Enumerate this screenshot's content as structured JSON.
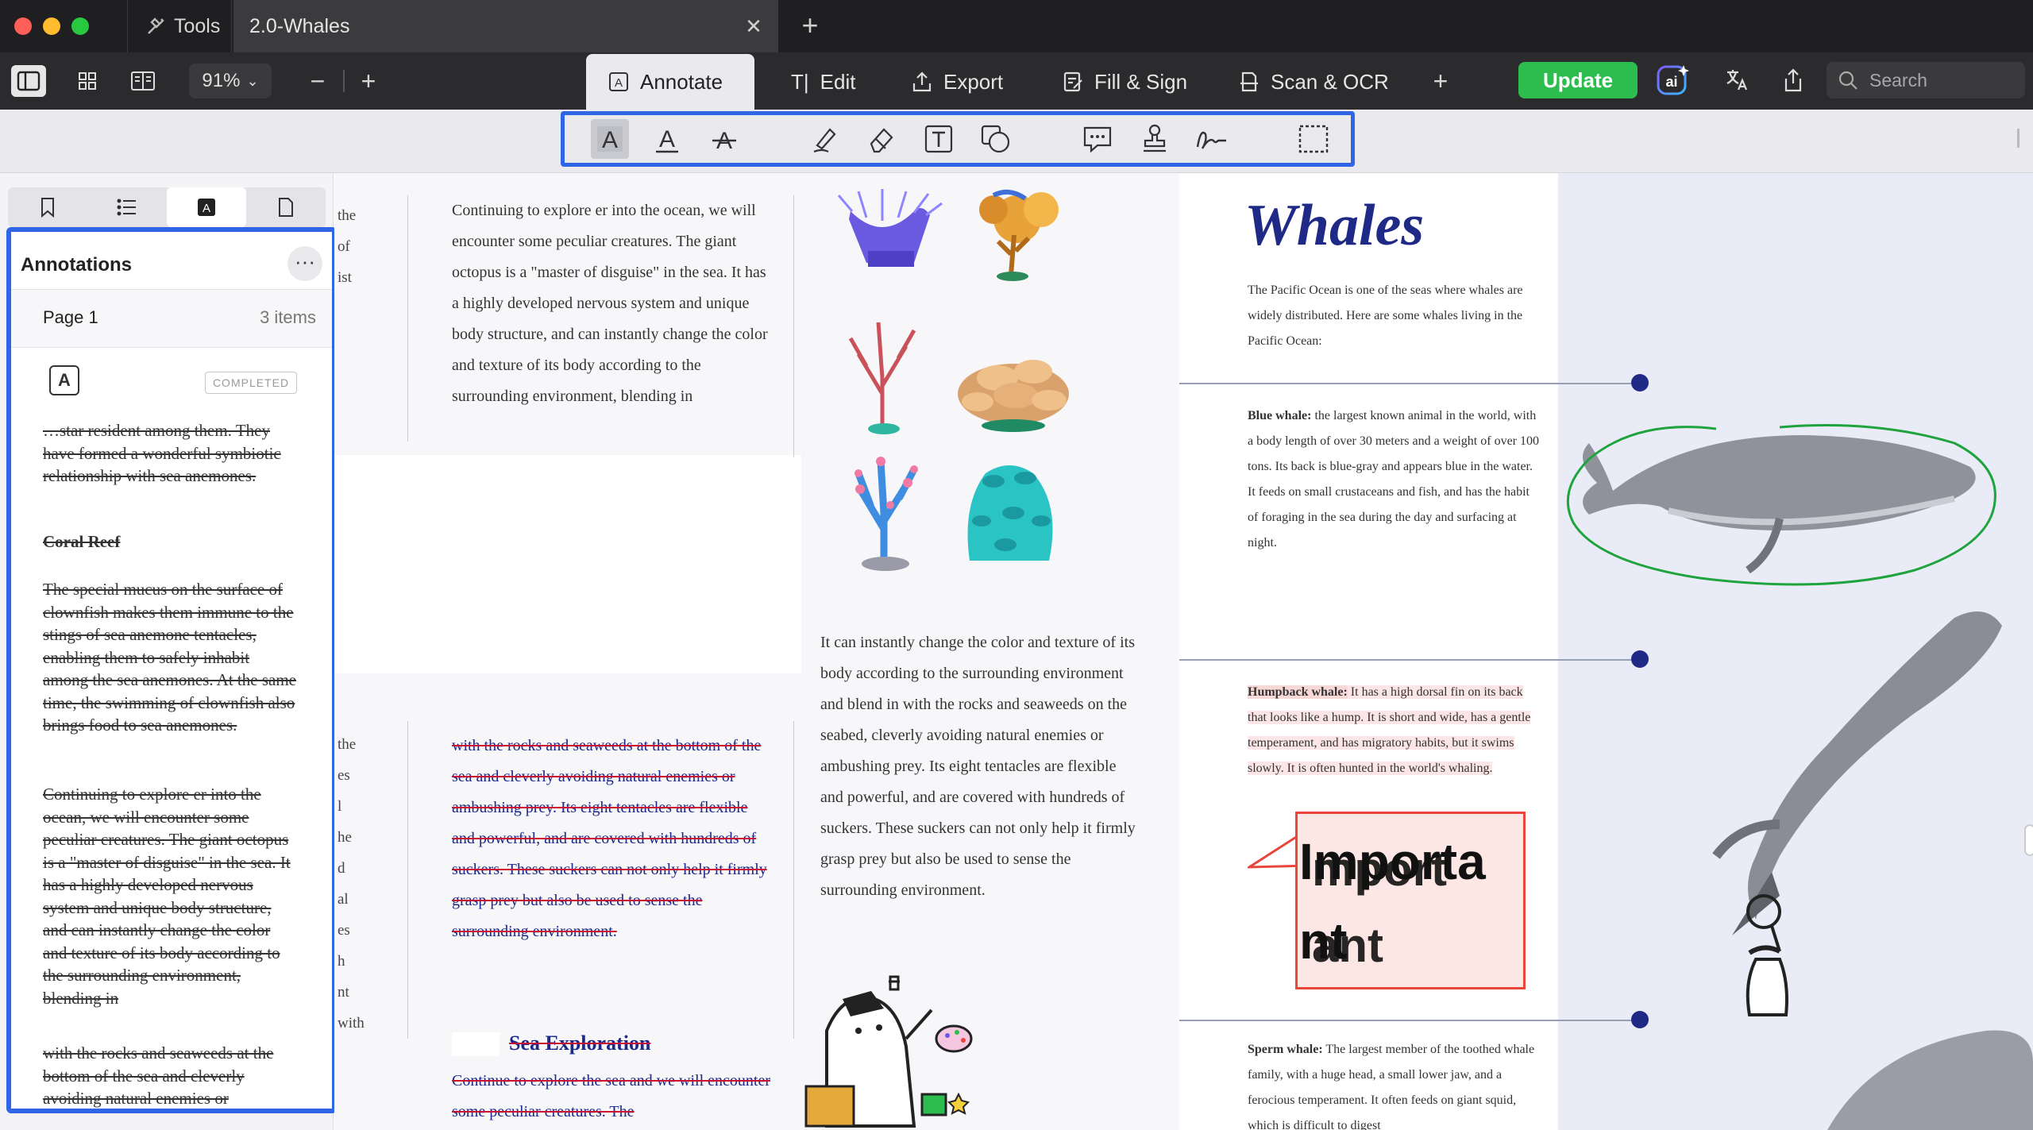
{
  "window": {
    "tool_tab": "Tools",
    "doc_tab": "2.0-Whales"
  },
  "toolbar": {
    "zoom": "91%",
    "modes": [
      "Annotate",
      "Edit",
      "Export",
      "Fill & Sign",
      "Scan & OCR"
    ],
    "update": "Update",
    "search_placeholder": "Search"
  },
  "sidebar": {
    "title": "Annotations",
    "page_label": "Page 1",
    "items_count": "3 items",
    "badge": "COMPLETED",
    "texts": [
      "…star resident among them. They have formed a wonderful symbiotic relationship with sea anemones.",
      "Coral Reef",
      "The special mucus on the surface of clownfish makes them immune to the stings of sea anemone tentacles, enabling them to safely inhabit among the sea anemones. At the same time, the swimming of clownfish also brings food to sea anemones.",
      "Continuing to explore      er into the ocean, we will encounter some peculiar creatures. The giant octopus is a \"master of disguise\" in the      sea. It has a highly developed nervous system and unique body structure, and can instantly change the color and texture of its body according to the surrounding environment, blending in",
      "with the rocks and seaweeds at the bottom of the sea and cleverly avoiding natural enemies or ambushing prey. Its eight"
    ]
  },
  "document": {
    "col1_top": "Continuing to explore       er into the ocean, we will encounter some peculiar creatures. The giant octopus is a \"master of disguise\" in the       sea. It has a highly developed nervous system and unique body structure, and can instantly change the color and texture of its body according to the surrounding environment, blending in",
    "col1_bottom": "with the rocks and seaweeds at the bottom of the sea and cleverly avoiding natural enemies or ambushing prey. Its eight tentacles are flexible and powerful, and are covered with hundreds of suckers. These suckers can not only help it firmly grasp prey but also be used to sense the surrounding environment.",
    "sea_exploration_title": "Sea Exploration",
    "sea_exploration_text": "Continue to explore the        sea and we will encounter some peculiar creatures. The",
    "col2_text": "It can instantly change the color and texture of its body according to the surrounding environment and blend in with the rocks and seaweeds on the seabed, cleverly avoiding natural enemies or ambushing prey. Its eight tentacles are flexible and powerful, and are covered with hundreds of suckers. These suckers can not only help it firmly grasp prey but also be used to sense the surrounding environment.",
    "left_fragments_top": [
      "the",
      "of",
      "ist"
    ],
    "left_fragments_bottom": [
      "the",
      "es",
      "l",
      "he",
      "d",
      "al",
      "es",
      "h",
      "nt",
      "with"
    ],
    "whales_title": "Whales",
    "whales_intro": "The Pacific Ocean is one of the seas where whales are widely distributed. Here are some whales living in the Pacific Ocean:",
    "blue_whale_label": "Blue whale:",
    "blue_whale_text": " the largest known animal in the world, with a body length of over 30 meters and a weight of over 100 tons. Its back is blue-gray and appears blue in the water. It feeds on small crustaceans and fish, and has the habit of foraging in the       sea during the day and surfacing at night.",
    "humpback_label": "Humpback whale:",
    "humpback_text": " It has a high dorsal fin on its back that looks like a hump. It is short and wide, has a gentle temperament, and has migratory habits, but it swims slowly. It is often hunted in the world's whaling.",
    "sperm_label": "Sperm whale:",
    "sperm_text": " The largest member of the toothed whale family, with a huge head, a small lower jaw, and a ferocious temperament. It often feeds on giant squid, which is difficult to digest",
    "callout_line1": "Importa",
    "callout_line2": "nt",
    "callout_overlay1": "mport",
    "callout_overlay2": "ant"
  },
  "colors": {
    "accent": "#2f66e6",
    "update": "#2dbd4e",
    "strike": "#c13",
    "callout": "#e8453c",
    "lasso": "#1fa33c"
  }
}
